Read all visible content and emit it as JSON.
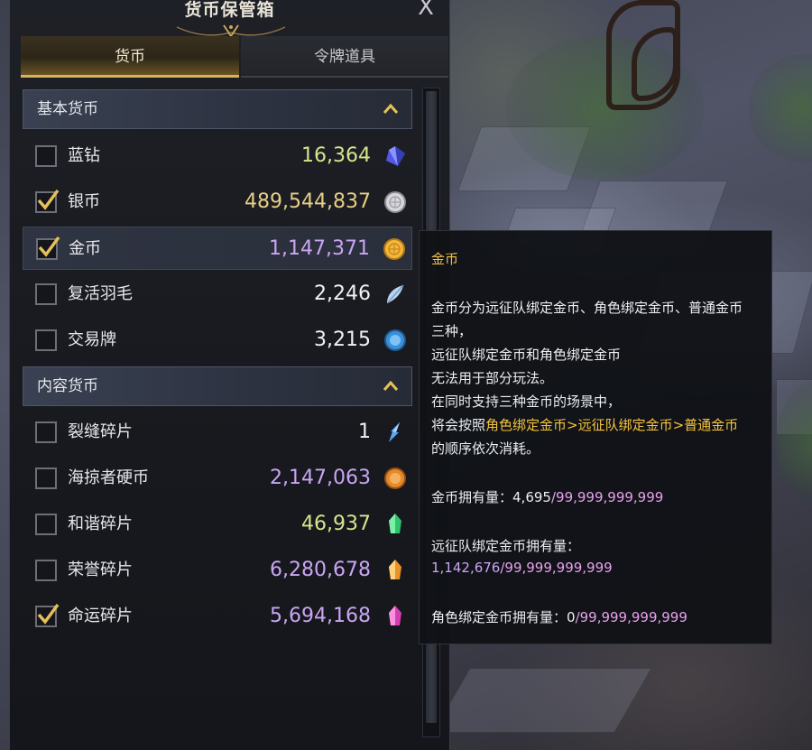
{
  "window": {
    "title": "货币保管箱",
    "close_glyph": "X"
  },
  "tabs": [
    {
      "label": "货币",
      "active": true
    },
    {
      "label": "令牌道具",
      "active": false
    }
  ],
  "sections": [
    {
      "label": "基本货币",
      "expanded": true,
      "icon": "chevron-up-icon"
    },
    {
      "label": "内容货币",
      "expanded": true,
      "icon": "chevron-up-icon"
    }
  ],
  "basic_currency": [
    {
      "name": "蓝钻",
      "value": "16,364",
      "checked": false,
      "icon": "blue-diamond-icon",
      "value_color": "#d6e58c"
    },
    {
      "name": "银币",
      "value": "489,544,837",
      "checked": true,
      "icon": "silver-coin-icon",
      "value_color": "#e8cf86"
    },
    {
      "name": "金币",
      "value": "1,147,371",
      "checked": true,
      "icon": "gold-coin-icon",
      "value_color": "#c9a6f3",
      "highlighted": true
    },
    {
      "name": "复活羽毛",
      "value": "2,246",
      "checked": false,
      "icon": "feather-icon",
      "value_color": "#f2f2f4"
    },
    {
      "name": "交易牌",
      "value": "3,215",
      "checked": false,
      "icon": "trade-token-icon",
      "value_color": "#f2f2f4"
    }
  ],
  "content_currency": [
    {
      "name": "裂缝碎片",
      "value": "1",
      "checked": false,
      "icon": "rift-shard-icon",
      "value_color": "#f2f2f4"
    },
    {
      "name": "海掠者硬币",
      "value": "2,147,063",
      "checked": false,
      "icon": "pirate-coin-icon",
      "value_color": "#c9a6f3"
    },
    {
      "name": "和谐碎片",
      "value": "46,937",
      "checked": false,
      "icon": "harmony-shard-icon",
      "value_color": "#d6e58c"
    },
    {
      "name": "荣誉碎片",
      "value": "6,280,678",
      "checked": false,
      "icon": "honor-shard-icon",
      "value_color": "#c9a6f3"
    },
    {
      "name": "命运碎片",
      "value": "5,694,168",
      "checked": true,
      "icon": "destiny-shard-icon",
      "value_color": "#c9a6f3"
    }
  ],
  "tooltip": {
    "title": "金币",
    "desc_line1": "金币分为远征队绑定金币、角色绑定金币、普通金币",
    "desc_line2": "三种，",
    "desc_line3": "远征队绑定金币和角色绑定金币",
    "desc_line4": "无法用于部分玩法。",
    "desc_line5": "在同时支持三种金币的场景中，",
    "desc_line6_prefix": "将会按照",
    "desc_line6_order": "角色绑定金币>远征队绑定金币>普通金币",
    "desc_line7": "的顺序依次消耗。",
    "gold_owned_label": "金币拥有量：",
    "gold_owned_value": "4,695",
    "gold_owned_max": "/99,999,999,999",
    "roster_bound_label": "远征队绑定金币拥有量：",
    "roster_bound_value": "1,142,676",
    "roster_bound_max": "/99,999,999,999",
    "char_bound_label": "角色绑定金币拥有量：",
    "char_bound_value": "0",
    "char_bound_max": "/99,999,999,999"
  }
}
